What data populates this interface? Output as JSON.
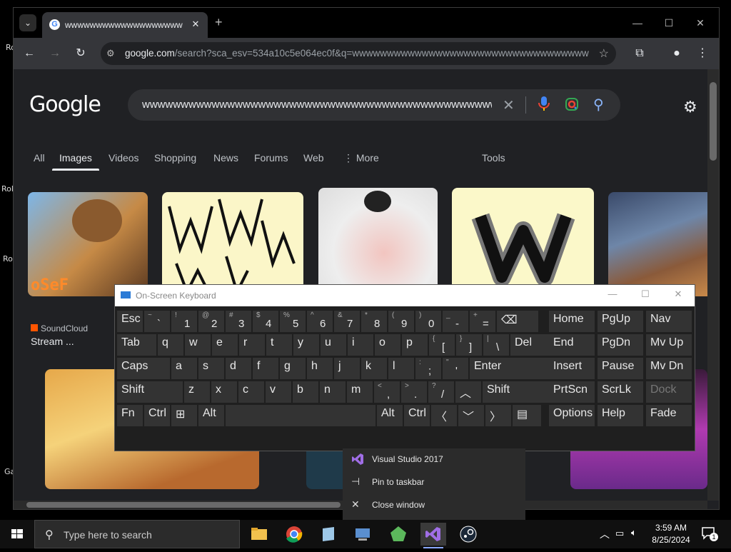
{
  "browser": {
    "tab_title": "wwwwwwwwwwwwwwwwwww",
    "url_host": "google.com",
    "url_rest": "/search?sca_esv=534a10c5e064ec0f&q=wwwwwwwwwwwwwwwwwwwwwwwwwwwwwwwwwwwwww..."
  },
  "google": {
    "logo": "Google",
    "query": "wwwwwwwwwwwwwwwwwwwwwwwwwwwwwwwwwwwwwwwwwwwwwwwwwww",
    "tabs": [
      "All",
      "Images",
      "Videos",
      "Shopping",
      "News",
      "Forums",
      "Web",
      "More",
      "Tools"
    ],
    "result_source": "SoundCloud",
    "result_title": "Stream ..."
  },
  "osk": {
    "title": "On-Screen Keyboard",
    "row1": [
      {
        "s": "~",
        "m": "`"
      },
      {
        "s": "!",
        "m": "1"
      },
      {
        "s": "@",
        "m": "2"
      },
      {
        "s": "#",
        "m": "3"
      },
      {
        "s": "$",
        "m": "4"
      },
      {
        "s": "%",
        "m": "5"
      },
      {
        "s": "^",
        "m": "6"
      },
      {
        "s": "&",
        "m": "7"
      },
      {
        "s": "*",
        "m": "8"
      },
      {
        "s": "(",
        "m": "9"
      },
      {
        "s": ")",
        "m": "0"
      },
      {
        "s": "_",
        "m": "-"
      },
      {
        "s": "+",
        "m": "="
      }
    ],
    "labels": {
      "esc": "Esc",
      "tab": "Tab",
      "caps": "Caps",
      "shift": "Shift",
      "fn": "Fn",
      "ctrl": "Ctrl",
      "alt": "Alt",
      "del": "Del",
      "enter": "Enter",
      "home": "Home",
      "pgup": "PgUp",
      "nav": "Nav",
      "end": "End",
      "pgdn": "PgDn",
      "mvup": "Mv Up",
      "insert": "Insert",
      "pause": "Pause",
      "mvdn": "Mv Dn",
      "prtscn": "PrtScn",
      "scrlk": "ScrLk",
      "dock": "Dock",
      "options": "Options",
      "help": "Help",
      "fade": "Fade"
    },
    "row2": [
      "q",
      "w",
      "e",
      "r",
      "t",
      "y",
      "u",
      "i",
      "o",
      "p"
    ],
    "row3": [
      "a",
      "s",
      "d",
      "f",
      "g",
      "h",
      "j",
      "k",
      "l"
    ],
    "row4": [
      "z",
      "x",
      "c",
      "v",
      "b",
      "n",
      "m"
    ],
    "punct2": [
      {
        "s": "{",
        "m": "["
      },
      {
        "s": "}",
        "m": "]"
      },
      {
        "s": "|",
        "m": "\\"
      }
    ],
    "punct3": [
      {
        "s": ":",
        "m": ";"
      },
      {
        "s": "\"",
        "m": "'"
      }
    ],
    "punct4": [
      {
        "s": "<",
        "m": ","
      },
      {
        "s": ">",
        "m": "."
      },
      {
        "s": "?",
        "m": "/"
      }
    ]
  },
  "context_menu": {
    "items": [
      "Visual Studio 2017",
      "Pin to taskbar",
      "Close window"
    ]
  },
  "taskbar": {
    "search_placeholder": "Type here to search",
    "time": "3:59 AM",
    "date": "8/25/2024",
    "notification_count": "1"
  },
  "desktop": {
    "fragments": [
      "Ro",
      "Rol",
      "Ro",
      "Ga"
    ]
  }
}
